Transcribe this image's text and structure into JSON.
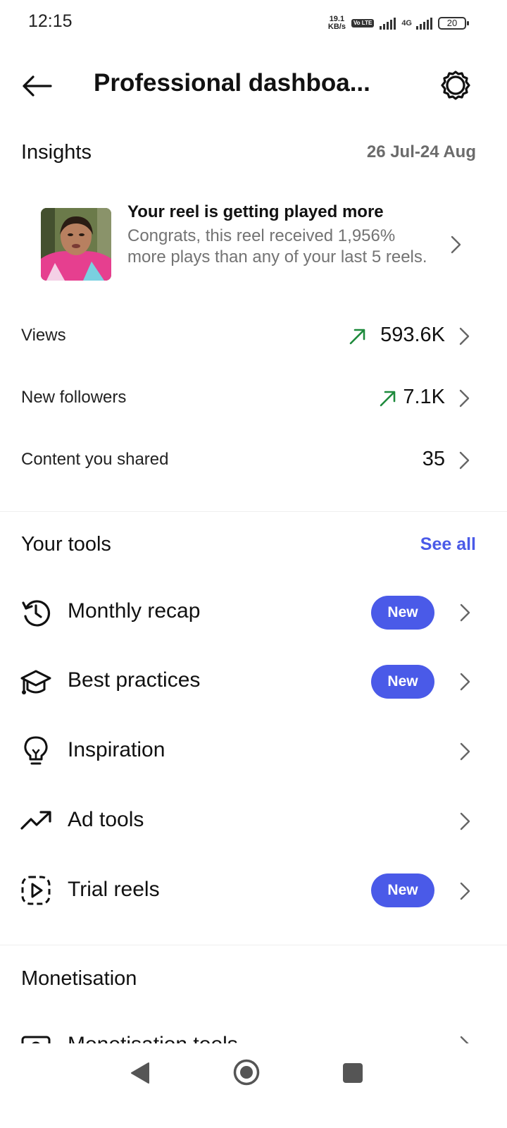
{
  "status_bar": {
    "time": "12:15",
    "net_speed_value": "19.1",
    "net_speed_unit": "KB/s",
    "volte": "Vo LTE",
    "network": "4G",
    "battery": "20"
  },
  "header": {
    "title": "Professional dashboa...",
    "back_icon": "arrow-left-icon",
    "settings_icon": "gear-icon"
  },
  "insights": {
    "title": "Insights",
    "date_range": "26 Jul-24 Aug",
    "reel_card": {
      "title": "Your reel is getting played more",
      "description": "Congrats, this reel received 1,956% more plays than any of your last 5 reels."
    },
    "metrics": [
      {
        "label": "Views",
        "value": "593.6K",
        "trend": "up"
      },
      {
        "label": "New followers",
        "value": "7.1K",
        "trend": "up"
      },
      {
        "label": "Content you shared",
        "value": "35",
        "trend": "none"
      }
    ]
  },
  "tools": {
    "title": "Your tools",
    "see_all": "See all",
    "items": [
      {
        "label": "Monthly recap",
        "icon": "history-clock-icon",
        "badge": "New"
      },
      {
        "label": "Best practices",
        "icon": "graduation-cap-icon",
        "badge": "New"
      },
      {
        "label": "Inspiration",
        "icon": "lightbulb-icon",
        "badge": ""
      },
      {
        "label": "Ad tools",
        "icon": "trending-up-icon",
        "badge": ""
      },
      {
        "label": "Trial reels",
        "icon": "reel-play-icon",
        "badge": "New"
      }
    ]
  },
  "monetisation": {
    "title": "Monetisation",
    "items": [
      {
        "label": "Monetisation tools",
        "icon": "money-icon"
      }
    ]
  },
  "colors": {
    "accent": "#4a5ae8",
    "trend_up": "#1e8a3c",
    "muted_text": "#737373"
  }
}
